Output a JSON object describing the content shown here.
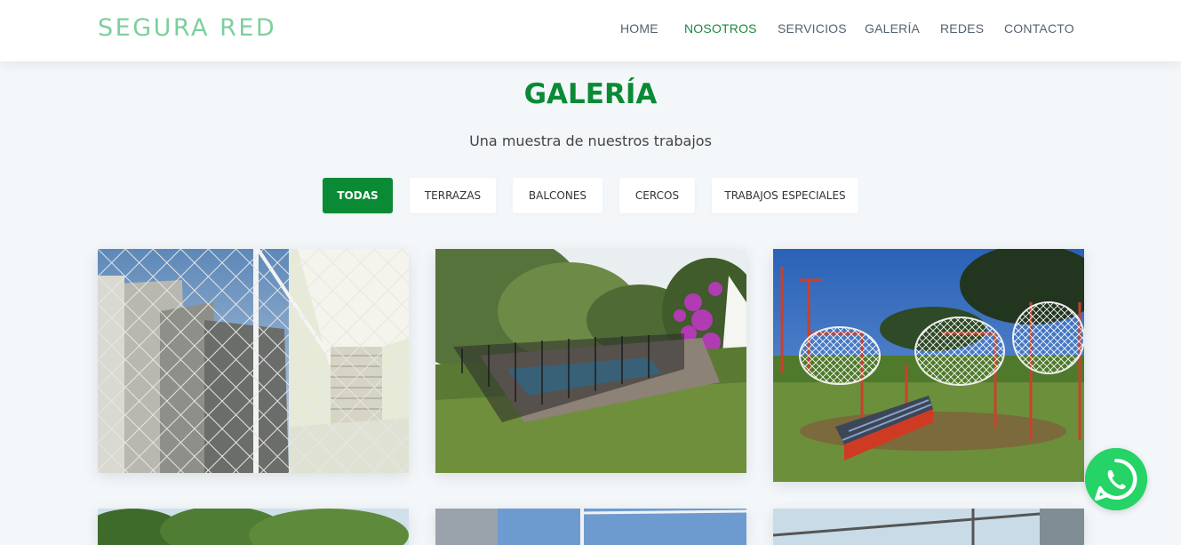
{
  "brand": "SEGURA RED",
  "nav": {
    "home": "HOME",
    "nosotros": "NOSOTROS",
    "servicios": "SERVICIOS",
    "galeria": "GALERÍA",
    "redes": "REDES",
    "contacto": "CONTACTO"
  },
  "gallery": {
    "title": "GALERÍA",
    "subtitle": "Una muestra de nuestros trabajos",
    "filters": {
      "todas": "TODAS",
      "terrazas": "TERRAZAS",
      "balcones": "BALCONES",
      "cercos": "CERCOS",
      "especiales": "TRABAJOS ESPECIALES"
    }
  },
  "colors": {
    "brand": "#7dcf9c",
    "accent": "#0a8a35",
    "whatsapp": "#25d366"
  },
  "icons": {
    "whatsapp": "whatsapp-icon"
  }
}
